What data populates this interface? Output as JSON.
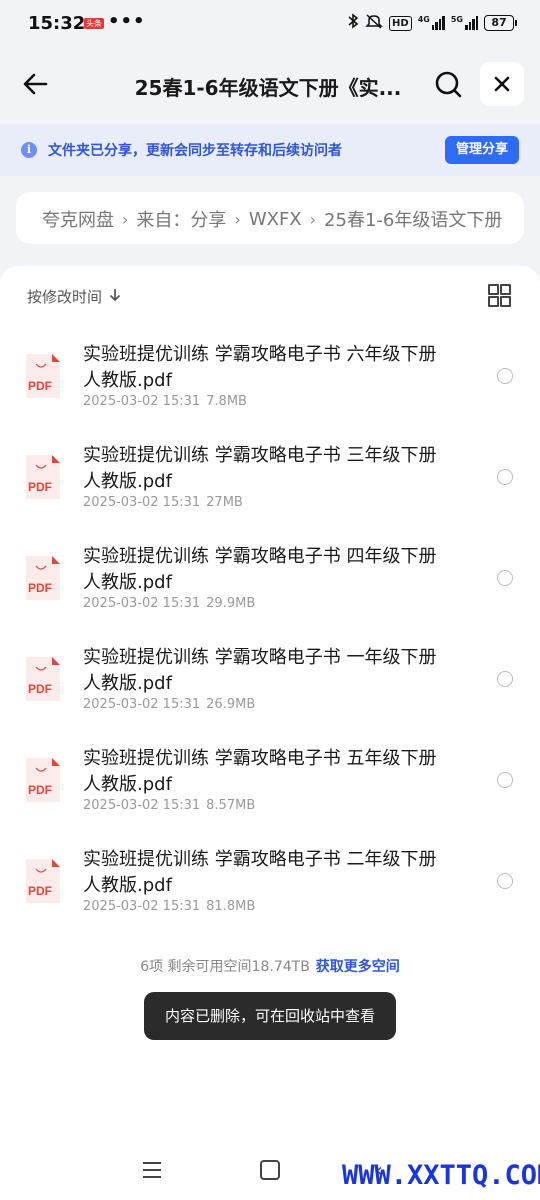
{
  "status_bar": {
    "time": "15:32",
    "badge": "头条",
    "dots": "•••",
    "hd": "HD",
    "net1": "4G",
    "net2": "5G",
    "battery": "87"
  },
  "header": {
    "title": "25春1-6年级语文下册《实...",
    "back_icon": "back-arrow-icon",
    "search_icon": "search-icon",
    "close_icon": "close-icon"
  },
  "notice": {
    "text": "文件夹已分享，更新会同步至转存和后续访问者",
    "button": "管理分享"
  },
  "breadcrumb": [
    "夸克网盘",
    "来自：分享",
    "WXFX",
    "25春1-6年级语文下册"
  ],
  "list": {
    "sort_label": "按修改时间",
    "files": [
      {
        "name": "实验班提优训练 学霸攻略电子书 六年级下册人教版.pdf",
        "date": "2025-03-02 15:31",
        "size": "7.8MB"
      },
      {
        "name": "实验班提优训练 学霸攻略电子书 三年级下册人教版.pdf",
        "date": "2025-03-02 15:31",
        "size": "27MB"
      },
      {
        "name": "实验班提优训练 学霸攻略电子书 四年级下册人教版.pdf",
        "date": "2025-03-02 15:31",
        "size": "29.9MB"
      },
      {
        "name": "实验班提优训练 学霸攻略电子书 一年级下册人教版.pdf",
        "date": "2025-03-02 15:31",
        "size": "26.9MB"
      },
      {
        "name": "实验班提优训练 学霸攻略电子书 五年级下册人教版.pdf",
        "date": "2025-03-02 15:31",
        "size": "8.57MB"
      },
      {
        "name": "实验班提优训练 学霸攻略电子书 二年级下册人教版.pdf",
        "date": "2025-03-02 15:31",
        "size": "81.8MB"
      }
    ],
    "pdf_label": "PDF"
  },
  "footer": {
    "summary": "6项  剩余可用空间18.74TB",
    "link": "获取更多空间"
  },
  "toast": "内容已删除，可在回收站中查看",
  "watermark": "WWW.XXTTQ.COM",
  "colors": {
    "accent": "#2f6cf6",
    "notice_bg": "#e9ecf9",
    "pdf_red": "#e0483e"
  }
}
